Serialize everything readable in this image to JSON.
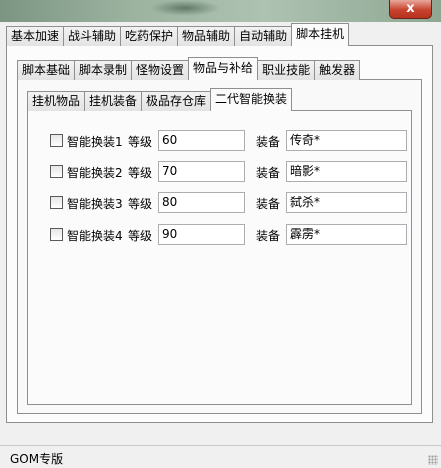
{
  "window": {
    "close_glyph": "x"
  },
  "main_tabs": [
    "基本加速",
    "战斗辅助",
    "吃药保护",
    "物品辅助",
    "自动辅助",
    "脚本挂机"
  ],
  "main_tabs_active": "脚本挂机",
  "sub_tabs": [
    "脚本基础",
    "脚本录制",
    "怪物设置",
    "物品与补给",
    "职业技能",
    "触发器"
  ],
  "sub_tabs_active": "物品与补给",
  "inner_tabs": [
    "挂机物品",
    "挂机装备",
    "极品存仓库",
    "二代智能换装"
  ],
  "inner_tabs_active": "二代智能换装",
  "equip_rows": [
    {
      "label": "智能换装1",
      "level_label": "等级",
      "level": "60",
      "equip_label": "装备",
      "equip": "传奇*",
      "checked": false
    },
    {
      "label": "智能换装2",
      "level_label": "等级",
      "level": "70",
      "equip_label": "装备",
      "equip": "暗影*",
      "checked": false
    },
    {
      "label": "智能换装3",
      "level_label": "等级",
      "level": "80",
      "equip_label": "装备",
      "equip": "弑杀*",
      "checked": false
    },
    {
      "label": "智能换装4",
      "level_label": "等级",
      "level": "90",
      "equip_label": "装备",
      "equip": "霹雳*",
      "checked": false
    }
  ],
  "status": {
    "text": "GOM专版"
  }
}
